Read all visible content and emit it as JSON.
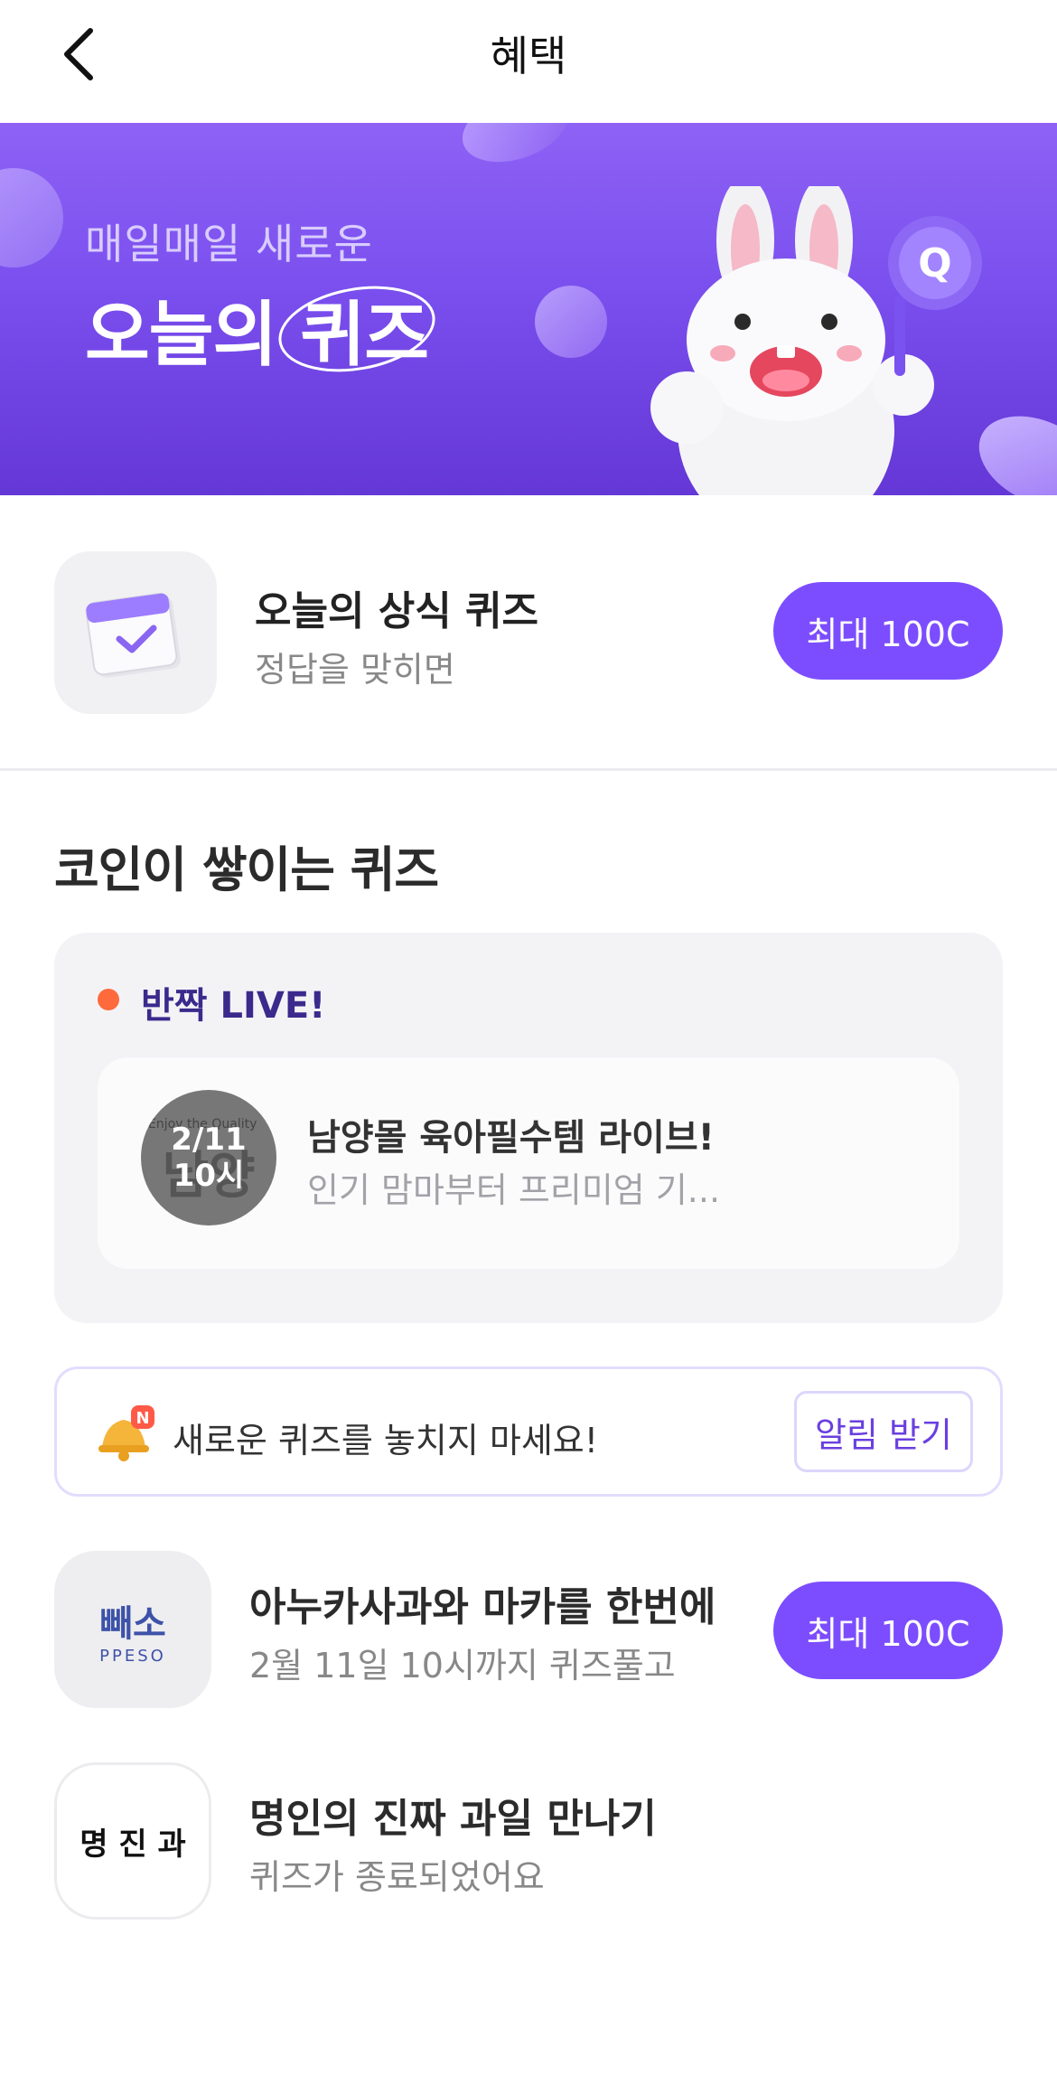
{
  "header": {
    "title": "혜택"
  },
  "banner": {
    "subtitle": "매일매일 새로운",
    "title": "오늘의 퀴즈",
    "badge_letter": "Q"
  },
  "today_quiz": {
    "title": "오늘의 상식 퀴즈",
    "subtitle": "정답을 맞히면",
    "button": "최대 100C"
  },
  "section": {
    "title": "코인이 쌓이는 퀴즈"
  },
  "live": {
    "label": "반짝 LIVE!",
    "thumb_line1": "2/11",
    "thumb_line2": "10시",
    "thumb_brand": "남양",
    "thumb_tagline": "Enjoy the Quality",
    "title": "남양몰 육아필수템 라이브!",
    "description": "인기 맘마부터 프리미엄 기..."
  },
  "notify": {
    "text": "새로운 퀴즈를 놓치지 마세요!",
    "button": "알림 받기",
    "badge": "N"
  },
  "quizzes": [
    {
      "logo_main": "빼소",
      "logo_sub": "PPESO",
      "title": "아누카사과와 마카를 한번에",
      "subtitle": "2월 11일 10시까지 퀴즈풀고",
      "button": "최대 100C"
    },
    {
      "logo_main": "명 진 과",
      "title": "명인의 진짜 과일 만나기",
      "subtitle": "퀴즈가 종료되었어요"
    }
  ],
  "colors": {
    "accent": "#7c4dff",
    "live_dot": "#ff6a3d",
    "banner_top": "#8e62f5",
    "banner_bottom": "#6437d6"
  }
}
